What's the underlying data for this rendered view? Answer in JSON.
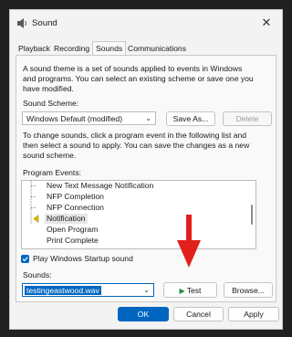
{
  "window": {
    "title": "Sound",
    "close_glyph": "✕"
  },
  "tabs": [
    {
      "label": "Playback"
    },
    {
      "label": "Recording"
    },
    {
      "label": "Sounds",
      "active": true
    },
    {
      "label": "Communications"
    }
  ],
  "sounds": {
    "intro_line1": "A sound theme is a set of sounds applied to events in Windows",
    "intro_line2": "and programs.  You can select an existing scheme or save one you",
    "intro_line3": "have modified.",
    "scheme_label": "Sound Scheme:",
    "scheme_value": "Windows Default (modified)",
    "save_as_label": "Save As...",
    "delete_label": "Delete",
    "instr_line1": "To change sounds, click a program event in the following list and",
    "instr_line2": "then select a sound to apply.  You can save the changes as a new",
    "instr_line3": "sound scheme.",
    "events_label": "Program Events:",
    "events": [
      {
        "label": "New Text Message Notification",
        "has_sound": false
      },
      {
        "label": "NFP Completion",
        "has_sound": false
      },
      {
        "label": "NFP Connection",
        "has_sound": false
      },
      {
        "label": "Notification",
        "has_sound": true,
        "selected": true
      },
      {
        "label": "Open Program",
        "has_sound": false
      },
      {
        "label": "Print Complete",
        "has_sound": false
      }
    ],
    "startup_checkbox_label": "Play Windows Startup sound",
    "startup_checked": true,
    "sounds_label": "Sounds:",
    "sound_file": "testingeastwood.wav",
    "test_label": "Test",
    "browse_label": "Browse..."
  },
  "footer": {
    "ok_label": "OK",
    "cancel_label": "Cancel",
    "apply_label": "Apply"
  },
  "colors": {
    "accent": "#0067c0",
    "annotation_arrow": "#e0201b",
    "play_icon": "#1e8f3a"
  }
}
